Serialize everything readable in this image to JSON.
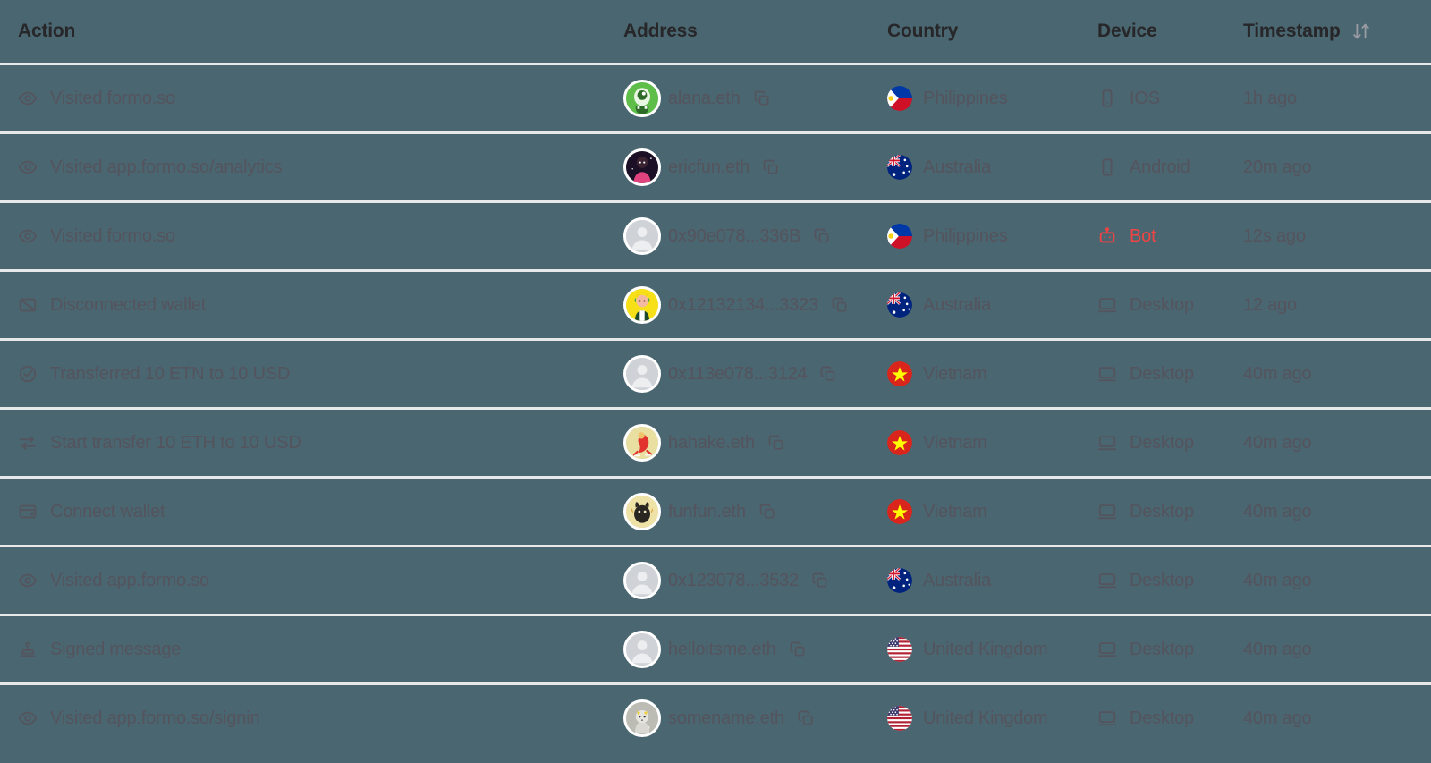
{
  "table": {
    "columns": [
      {
        "key": "action",
        "label": "Action",
        "sortable": false
      },
      {
        "key": "address",
        "label": "Address",
        "sortable": false
      },
      {
        "key": "country",
        "label": "Country",
        "sortable": false
      },
      {
        "key": "device",
        "label": "Device",
        "sortable": false
      },
      {
        "key": "timestamp",
        "label": "Timestamp",
        "sortable": true,
        "sort_icon": "sort-arrows-icon"
      }
    ],
    "rows": [
      {
        "action": "Visited formo.so",
        "action_icon": "eye-icon",
        "address": "alana.eth",
        "avatar": "monster-green-avatar",
        "copy_icon": "copy-icon",
        "country": "Philippines",
        "flag": "philippines-flag-icon",
        "device": "IOS",
        "device_icon": "smartphone-icon",
        "device_highlight": false,
        "timestamp": "1h ago"
      },
      {
        "action": "Visited app.formo.so/analytics",
        "action_icon": "eye-icon",
        "address": "ericfun.eth",
        "avatar": "pink-character-avatar",
        "copy_icon": "copy-icon",
        "country": "Australia",
        "flag": "australia-flag-icon",
        "device": "Android",
        "device_icon": "smartphone-icon",
        "device_highlight": false,
        "timestamp": "20m ago"
      },
      {
        "action": "Visited formo.so",
        "action_icon": "eye-icon",
        "address": "0x90e078...336B",
        "avatar": "default-person-avatar",
        "copy_icon": "copy-icon",
        "country": "Philippines",
        "flag": "philippines-flag-icon",
        "device": "Bot",
        "device_icon": "robot-icon",
        "device_highlight": true,
        "timestamp": "12s ago"
      },
      {
        "action": "Disconnected wallet",
        "action_icon": "wallet-slash-icon",
        "address": "0x12132134...3323",
        "avatar": "yellow-character-avatar",
        "copy_icon": "copy-icon",
        "country": "Australia",
        "flag": "australia-flag-icon",
        "device": "Desktop",
        "device_icon": "monitor-icon",
        "device_highlight": false,
        "timestamp": "12 ago"
      },
      {
        "action": "Transferred 10 ETN to 10 USD",
        "action_icon": "check-circle-icon",
        "address": "0x113e078...3124",
        "avatar": "default-person-avatar",
        "copy_icon": "copy-icon",
        "country": "Vietnam",
        "flag": "vietnam-flag-icon",
        "device": "Desktop",
        "device_icon": "monitor-icon",
        "device_highlight": false,
        "timestamp": "40m ago"
      },
      {
        "action": "Start transfer 10 ETH to 10 USD",
        "action_icon": "transfer-arrows-icon",
        "address": "hahake.eth",
        "avatar": "red-character-avatar",
        "copy_icon": "copy-icon",
        "country": "Vietnam",
        "flag": "vietnam-flag-icon",
        "device": "Desktop",
        "device_icon": "monitor-icon",
        "device_highlight": false,
        "timestamp": "40m ago"
      },
      {
        "action": "Connect wallet",
        "action_icon": "wallet-icon",
        "address": "funfun.eth",
        "avatar": "dark-creature-avatar",
        "copy_icon": "copy-icon",
        "country": "Vietnam",
        "flag": "vietnam-flag-icon",
        "device": "Desktop",
        "device_icon": "monitor-icon",
        "device_highlight": false,
        "timestamp": "40m ago"
      },
      {
        "action": "Visited app.formo.so",
        "action_icon": "eye-icon",
        "address": "0x123078...3532",
        "avatar": "default-person-avatar",
        "copy_icon": "copy-icon",
        "country": "Australia",
        "flag": "australia-flag-icon",
        "device": "Desktop",
        "device_icon": "monitor-icon",
        "device_highlight": false,
        "timestamp": "40m ago"
      },
      {
        "action": "Signed message",
        "action_icon": "signature-stamp-icon",
        "address": "helloitsme.eth",
        "avatar": "default-person-avatar",
        "copy_icon": "copy-icon",
        "country": "United Kingdom",
        "flag": "usa-flag-icon",
        "device": "Desktop",
        "device_icon": "monitor-icon",
        "device_highlight": false,
        "timestamp": "40m ago"
      },
      {
        "action": "Visited app.formo.so/signin",
        "action_icon": "eye-icon",
        "address": "somename.eth",
        "avatar": "gray-animal-avatar",
        "copy_icon": "copy-icon",
        "country": "United Kingdom",
        "flag": "usa-flag-icon",
        "device": "Desktop",
        "device_icon": "monitor-icon",
        "device_highlight": false,
        "timestamp": "40m ago"
      }
    ]
  },
  "colors": {
    "background": "#4a6670",
    "divider": "#e8e8ea",
    "header_text": "#27272a",
    "body_text": "#54545e",
    "bot_accent": "#ef4444"
  }
}
